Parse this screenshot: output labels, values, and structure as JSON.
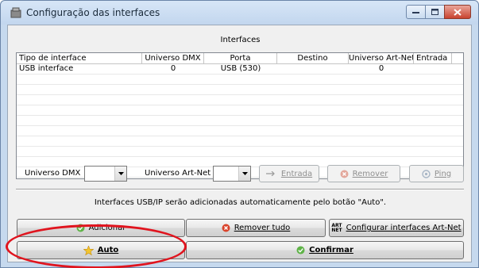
{
  "window": {
    "title": "Configuração das interfaces",
    "controls": {
      "minimize": "minimize",
      "maximize": "maximize",
      "close": "close"
    }
  },
  "interfaces_section_label": "Interfaces",
  "table": {
    "columns": [
      "Tipo de interface",
      "Universo DMX",
      "Porta",
      "Destino",
      "Universo Art-Net",
      "Entrada"
    ],
    "rows": [
      [
        "USB interface",
        "0",
        "USB (530)",
        "",
        "0",
        ""
      ]
    ]
  },
  "form": {
    "universe_dmx_label": "Universo DMX",
    "universe_dmx_value": "",
    "universe_artnet_label": "Universo Art-Net",
    "universe_artnet_value": "",
    "entrada_button": "Entrada",
    "remover_button": "Remover",
    "ping_button": "Ping"
  },
  "info_text": "Interfaces USB/IP serão adicionadas automaticamente pelo botão \"Auto\".",
  "buttons": {
    "adicionar": "Adicionar",
    "remover_tudo": "Remover tudo",
    "configurar_artnet": "Configurar interfaces Art-Net",
    "auto": "Auto",
    "confirmar": "Confirmar"
  },
  "icon_texts": {
    "artnet_icon_top": "ART",
    "artnet_icon_bottom": "NET"
  },
  "colors": {
    "highlight": "#e0141e",
    "title_bar": "#c2d6ee",
    "client_bg": "#f0f0f0"
  }
}
